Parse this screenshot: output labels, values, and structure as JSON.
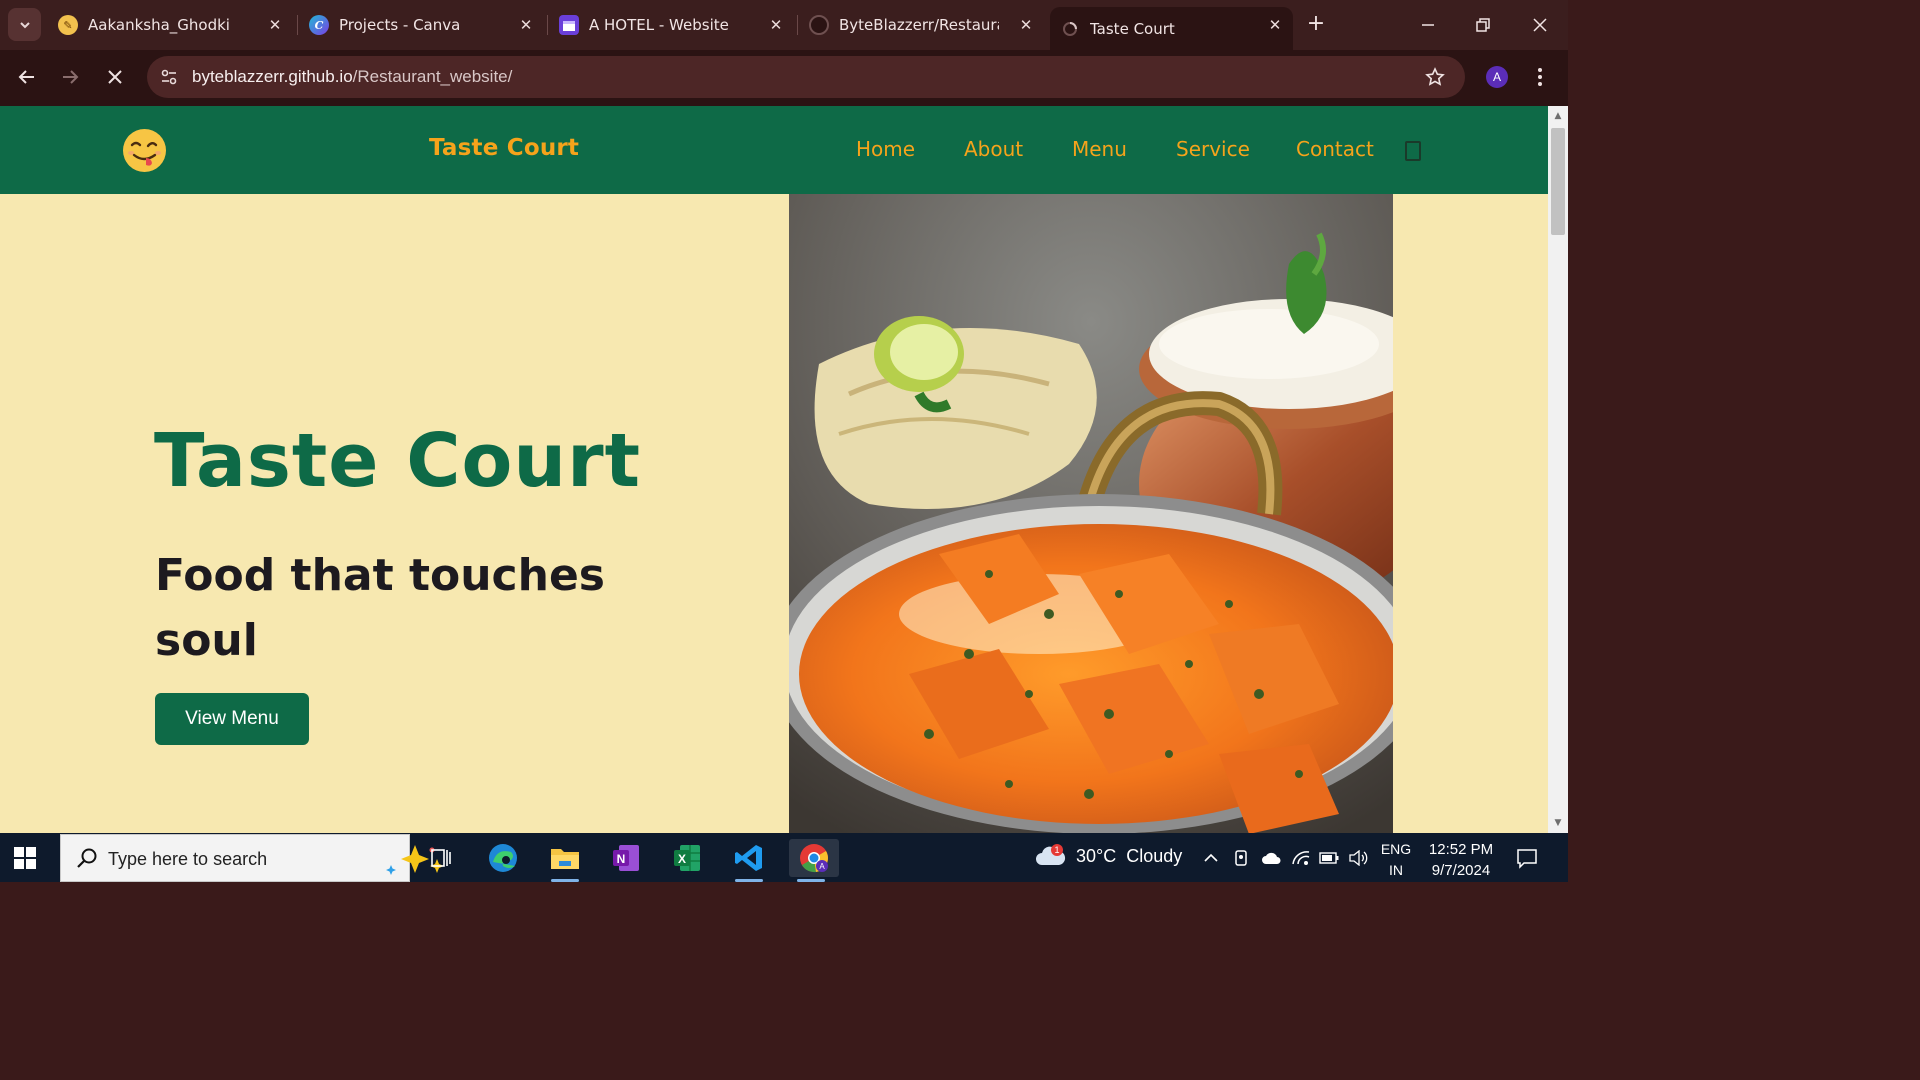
{
  "browser": {
    "tabs": [
      {
        "title": "Aakanksha_Ghodki",
        "favicon": "pencil-icon",
        "active": false
      },
      {
        "title": "Projects - Canva",
        "favicon": "canva-icon",
        "active": false
      },
      {
        "title": "A HOTEL - Website",
        "favicon": "calendar-icon",
        "active": false
      },
      {
        "title": "ByteBlazzerr/Restaurant_w",
        "favicon": "github-icon",
        "active": false
      },
      {
        "title": "Taste Court",
        "favicon": "loading-icon",
        "active": true
      }
    ],
    "url_host": "byteblazzerr.github.io",
    "url_path": "/Restaurant_website/",
    "profile_initial": "A",
    "colors": {
      "frame": "#3b1e1e",
      "toolbar": "#2b1313",
      "omnibox": "#4d2626"
    }
  },
  "site": {
    "brand": "Taste Court",
    "nav": [
      "Home",
      "About",
      "Menu",
      "Service",
      "Contact"
    ],
    "hero_title": "Taste Court",
    "hero_subtitle": "Food that touches soul",
    "hero_button": "View Menu",
    "colors": {
      "green": "#0e6a47",
      "accent": "#f5a31b",
      "cream": "#f7e8b0",
      "text": "#1d1a1f"
    }
  },
  "taskbar": {
    "search_placeholder": "Type here to search",
    "weather_temp": "30°C",
    "weather_condition": "Cloudy",
    "weather_badge": "1",
    "lang_primary": "ENG",
    "lang_region": "IN",
    "time": "12:52 PM",
    "date": "9/7/2024",
    "pinned": [
      "task-view-icon",
      "edge-icon",
      "file-explorer-icon",
      "onenote-icon",
      "excel-icon",
      "vscode-icon",
      "chrome-icon"
    ]
  }
}
